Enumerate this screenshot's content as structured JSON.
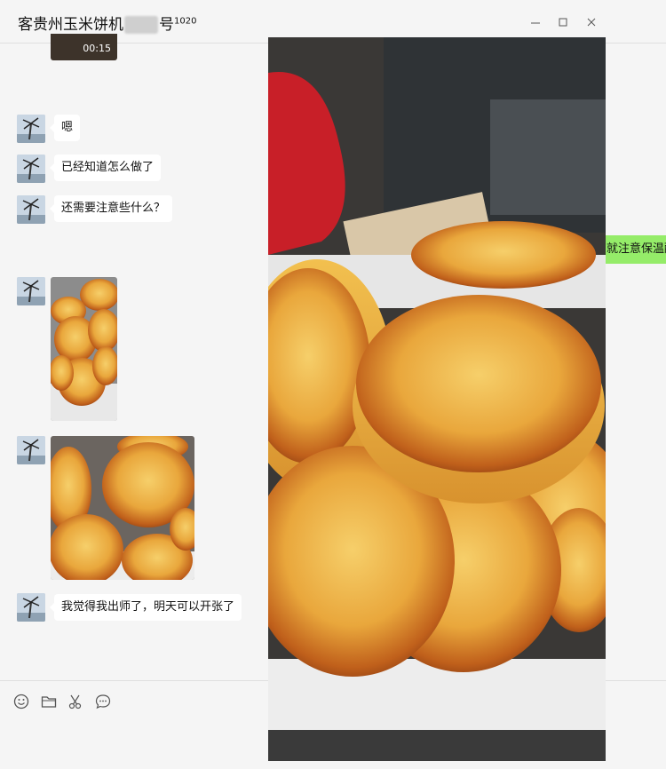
{
  "window": {
    "title_prefix": "客贵州玉米饼机",
    "title_suffix": "号",
    "title_superscript": "1020"
  },
  "video_duration": "00:15",
  "messages": [
    {
      "kind": "text",
      "text": "嗯"
    },
    {
      "kind": "text",
      "text": "已经知道怎么做了"
    },
    {
      "kind": "text",
      "text": "还需要注意些什么？"
    },
    {
      "kind": "image",
      "subject": "corn-cakes-photo"
    },
    {
      "kind": "image",
      "subject": "corn-cakes-photo"
    },
    {
      "kind": "text",
      "text": "我觉得我出师了，明天可以开张了"
    }
  ],
  "outgoing_partial_text": "就注意保温醒",
  "toolbar": {
    "icons": [
      "emoji-icon",
      "folder-icon",
      "scissors-icon",
      "chat-history-icon"
    ]
  },
  "colors": {
    "outgoing_bubble": "#95ec69",
    "incoming_bubble": "#ffffff",
    "background": "#f5f5f5"
  }
}
